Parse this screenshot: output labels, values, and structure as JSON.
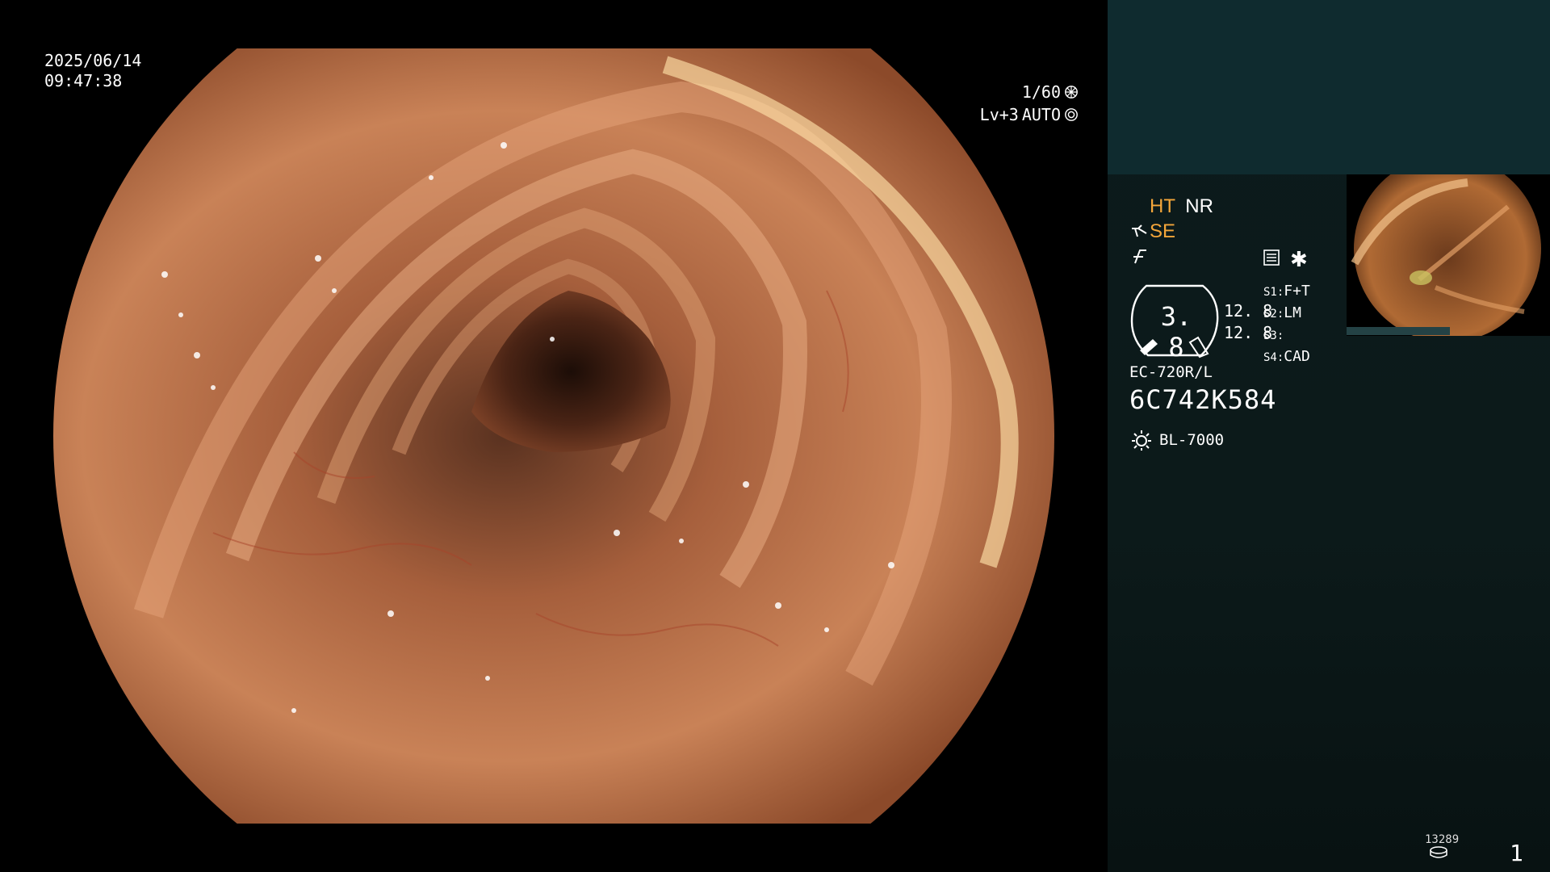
{
  "overlay": {
    "date": "2025/06/14",
    "time": "09:47:38",
    "shutter": "1/60",
    "level": "Lv+3",
    "mode": "AUTO"
  },
  "panel": {
    "ht": "HT",
    "nr": "NR",
    "se": "SE",
    "gauge_value": "3. 8",
    "val_a": "12. 8",
    "val_b": "12. 8",
    "s1_label": "S1",
    "s1_value": "F+T",
    "s2_label": "S2",
    "s2_value": "LM",
    "s3_label": "S3",
    "s3_value": "",
    "s4_label": "S4",
    "s4_value": "CAD",
    "scope_model": "EC-720R/L",
    "serial": "6C742K584",
    "light_source": "BL-7000",
    "counter": "13289",
    "page": "1"
  },
  "colors": {
    "accent_orange": "#f4a63a",
    "panel_teal": "#0f2b2f",
    "tissue": "#c77a4a"
  },
  "icons": [
    "aperture-icon",
    "iris-icon",
    "scope-tip-icon",
    "freeze-icon",
    "menu-icon",
    "asterisk-icon",
    "light-icon",
    "storage-icon"
  ]
}
